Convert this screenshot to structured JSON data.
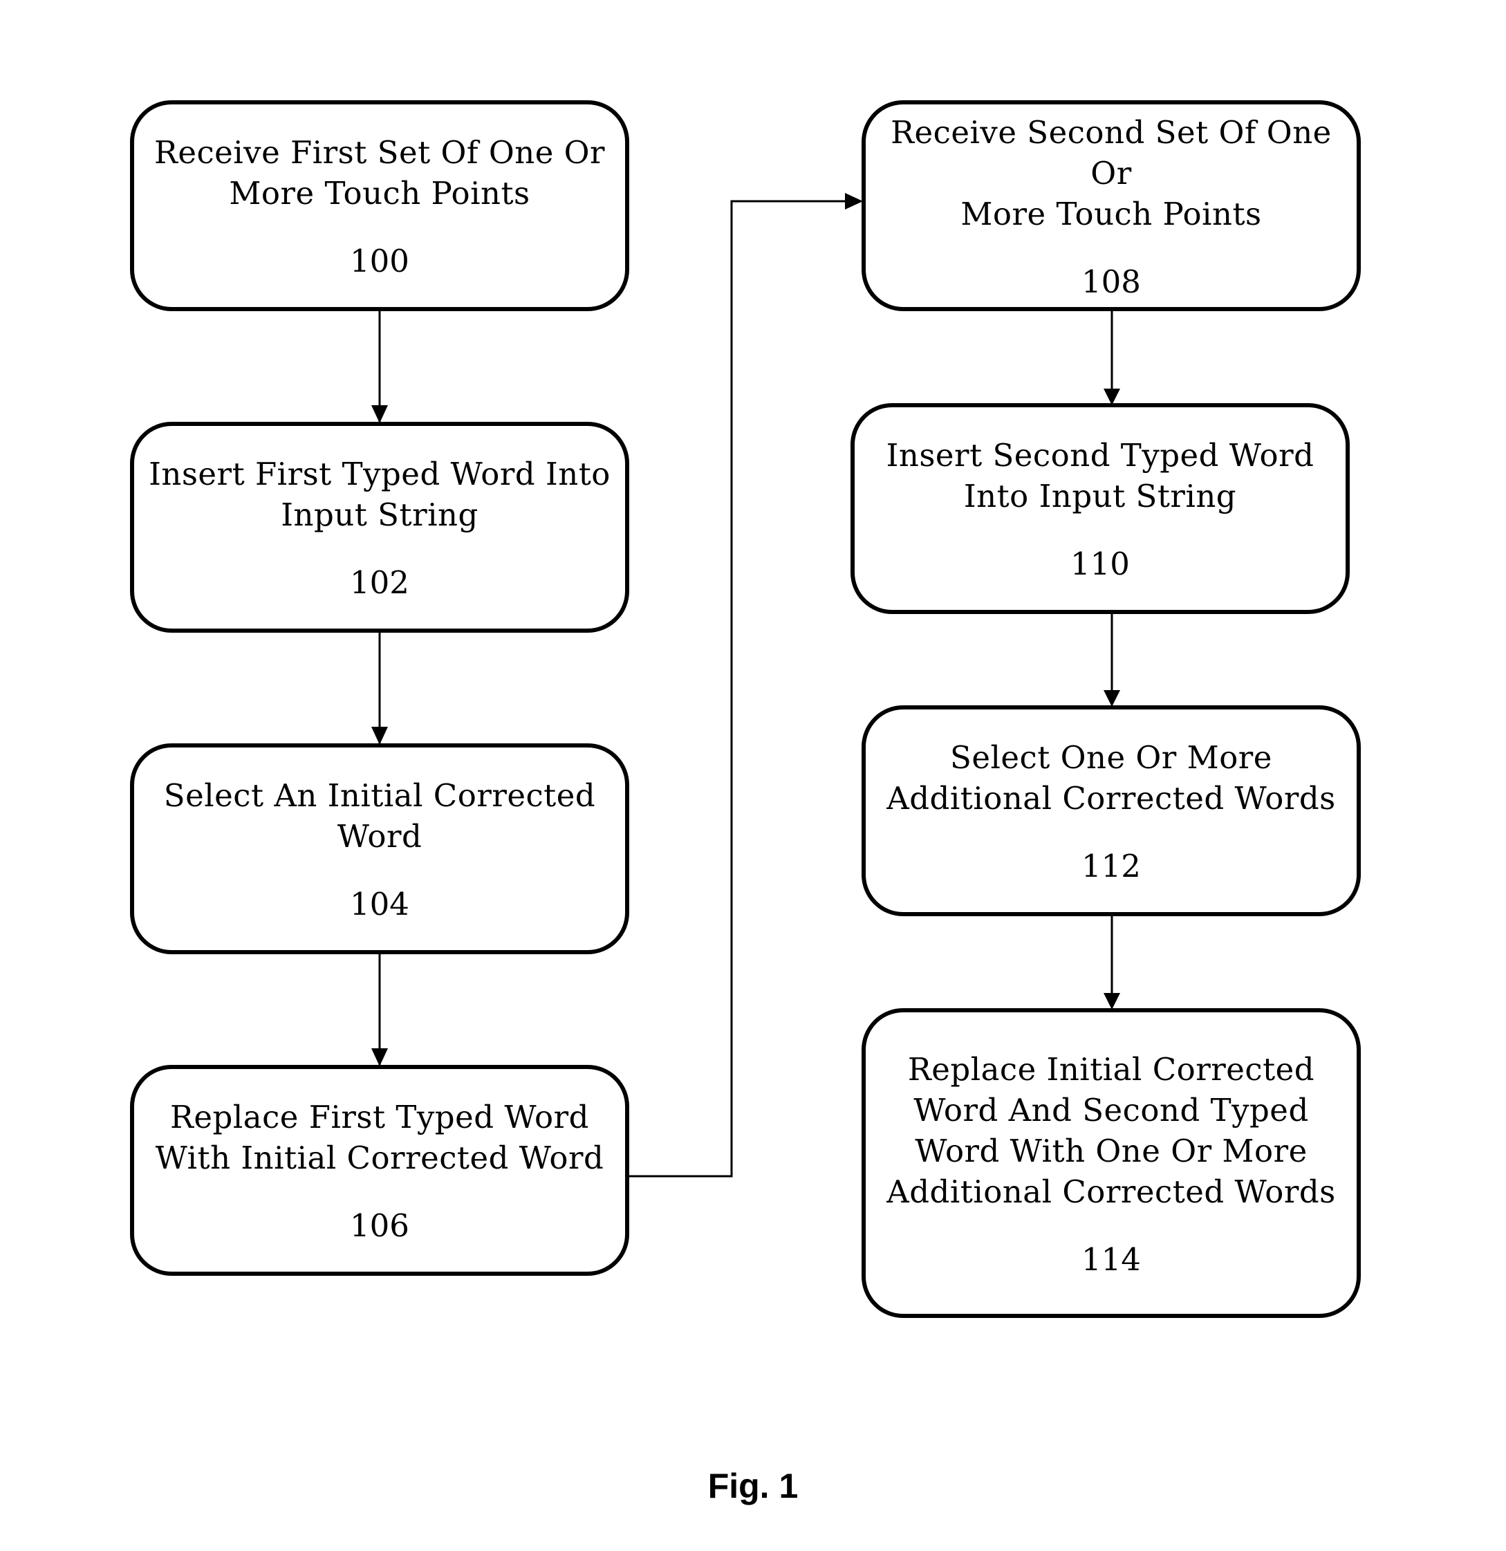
{
  "figure_label": "Fig. 1",
  "steps": [
    {
      "id": "100",
      "label_lines": [
        "Receive First Set Of One Or",
        "More Touch Points"
      ]
    },
    {
      "id": "102",
      "label_lines": [
        "Insert First Typed Word Into",
        "Input String"
      ]
    },
    {
      "id": "104",
      "label_lines": [
        "Select An Initial Corrected",
        "Word"
      ]
    },
    {
      "id": "106",
      "label_lines": [
        "Replace First Typed Word",
        "With Initial Corrected Word"
      ]
    },
    {
      "id": "108",
      "label_lines": [
        "Receive Second Set Of One Or",
        "More Touch Points"
      ]
    },
    {
      "id": "110",
      "label_lines": [
        "Insert Second Typed Word",
        "Into Input String"
      ]
    },
    {
      "id": "112",
      "label_lines": [
        "Select One Or More",
        "Additional Corrected Words"
      ]
    },
    {
      "id": "114",
      "label_lines": [
        "Replace Initial Corrected",
        "Word And Second Typed",
        "Word With One Or More",
        "Additional Corrected Words"
      ]
    }
  ],
  "connections": [
    {
      "from": "100",
      "to": "102"
    },
    {
      "from": "102",
      "to": "104"
    },
    {
      "from": "104",
      "to": "106"
    },
    {
      "from": "106",
      "to": "108"
    },
    {
      "from": "108",
      "to": "110"
    },
    {
      "from": "110",
      "to": "112"
    },
    {
      "from": "112",
      "to": "114"
    }
  ]
}
